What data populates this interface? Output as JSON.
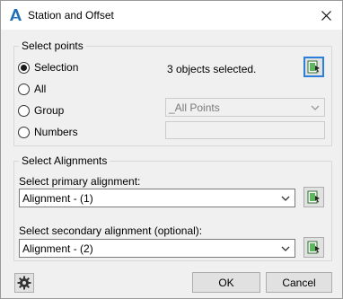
{
  "window": {
    "title": "Station and Offset"
  },
  "select_points": {
    "group_title": "Select points",
    "options": [
      {
        "label": "Selection",
        "selected": true
      },
      {
        "label": "All",
        "selected": false
      },
      {
        "label": "Group",
        "selected": false
      },
      {
        "label": "Numbers",
        "selected": false
      }
    ],
    "status": "3 objects selected.",
    "group_combo": {
      "value": "_All Points",
      "enabled": false
    },
    "numbers_field": {
      "value": "",
      "enabled": false
    }
  },
  "select_alignments": {
    "group_title": "Select Alignments",
    "primary_label": "Select primary alignment:",
    "primary_value": "Alignment - (1)",
    "secondary_label": "Select secondary alignment (optional):",
    "secondary_value": "Alignment - (2)"
  },
  "footer": {
    "ok_label": "OK",
    "cancel_label": "Cancel"
  },
  "icons": {
    "app": "autocad-a-icon",
    "close": "close-icon",
    "pick": "pick-in-drawing-icon",
    "settings": "gear-icon"
  },
  "colors": {
    "focus_border": "#2b7fd8",
    "dialog_bg": "#f0f0f0"
  }
}
